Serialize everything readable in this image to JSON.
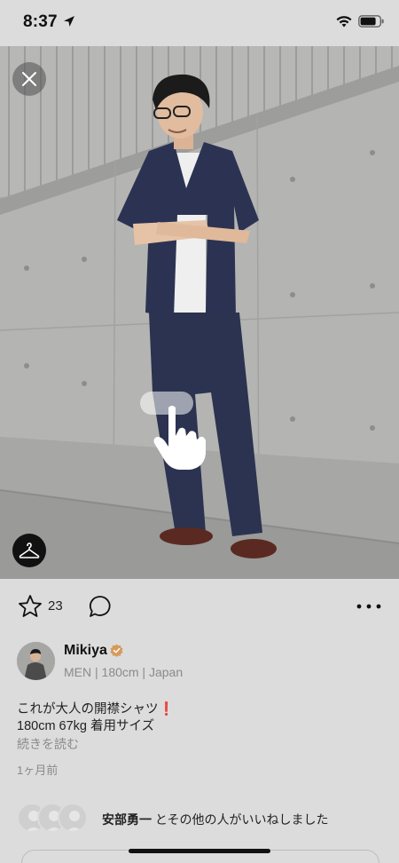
{
  "status_bar": {
    "time": "8:37"
  },
  "post": {
    "like_count": "23",
    "user": {
      "name": "Mikiya",
      "meta": "MEN | 180cm | Japan"
    },
    "caption": {
      "line1": "これが大人の開襟シャツ",
      "line1_emoji": "❗",
      "line2": "180cm 67kg 着用サイズ"
    },
    "read_more": "続きを読む",
    "time_ago": "1ヶ月前",
    "likes": {
      "name": "安部勇一",
      "suffix": " とその他の人がいいねしました"
    }
  },
  "icons": {
    "status": [
      "location-arrow-icon",
      "wifi-icon",
      "battery-icon"
    ],
    "photo": [
      "close-icon",
      "hanger-icon",
      "swipe-hand-icon"
    ],
    "actions": [
      "star-icon",
      "comment-icon",
      "more-icon"
    ],
    "user": [
      "verified-badge-icon"
    ]
  },
  "colors": {
    "background": "#dcdcdc",
    "badge": "#d59a5b",
    "emoji_red": "#d02a2a",
    "muted_text": "#8a8a8a"
  }
}
